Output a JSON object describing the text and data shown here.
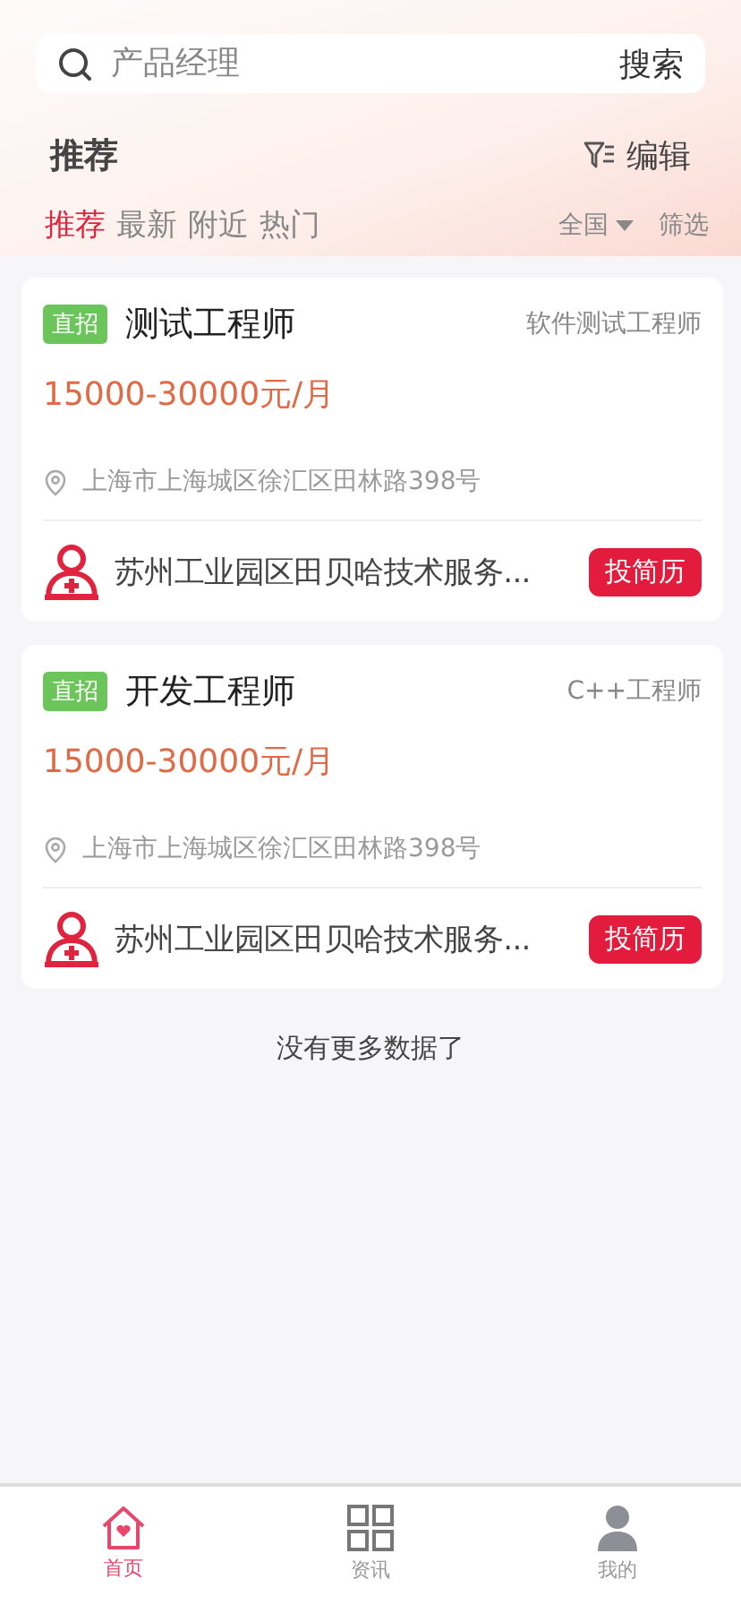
{
  "search": {
    "placeholder": "产品经理",
    "button": "搜索"
  },
  "section": {
    "title": "推荐",
    "edit": "编辑"
  },
  "tabs": [
    {
      "label": "推荐",
      "selected": true
    },
    {
      "label": "最新",
      "selected": false
    },
    {
      "label": "附近",
      "selected": false
    },
    {
      "label": "热门",
      "selected": false
    }
  ],
  "region": "全国",
  "filter": "筛选",
  "jobs": [
    {
      "tag": "直招",
      "title": "测试工程师",
      "category": "软件测试工程师",
      "salary": "15000-30000元/月",
      "address": "上海市上海城区徐汇区田林路398号",
      "company": "苏州工业园区田贝哈技术服务...",
      "apply": "投简历"
    },
    {
      "tag": "直招",
      "title": "开发工程师",
      "category": "C++工程师",
      "salary": "15000-30000元/月",
      "address": "上海市上海城区徐汇区田林路398号",
      "company": "苏州工业园区田贝哈技术服务...",
      "apply": "投简历"
    }
  ],
  "end_note": "没有更多数据了",
  "nav": [
    {
      "kind": "home",
      "label": "首页",
      "selected": true
    },
    {
      "kind": "grid",
      "label": "资讯",
      "selected": false
    },
    {
      "kind": "person",
      "label": "我的",
      "selected": false
    }
  ]
}
